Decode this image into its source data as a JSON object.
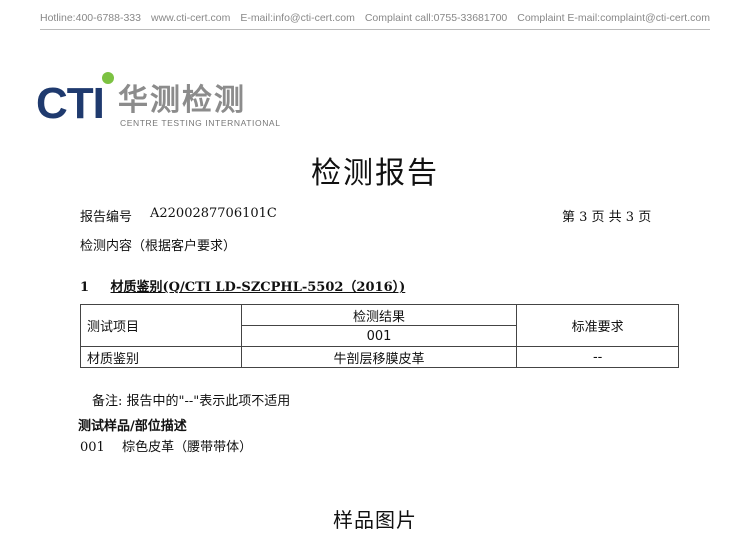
{
  "header": {
    "hotline": "Hotline:400-6788-333",
    "website": "www.cti-cert.com",
    "email": "E-mail:info@cti-cert.com",
    "complaint_call": "Complaint call:0755-33681700",
    "complaint_email": "Complaint E-mail:complaint@cti-cert.com"
  },
  "logo": {
    "brand": "CT",
    "brand_i": "I",
    "chinese": "华测检测",
    "english": "CENTRE TESTING INTERNATIONAL"
  },
  "title": "检测报告",
  "report": {
    "number_label": "报告编号",
    "number": "A2200287706101C",
    "page_info": "第 3 页   共 3 页",
    "content_label": "检测内容（根据客户要求）"
  },
  "section1": {
    "num": "1",
    "title": "材质鉴别(Q/CTI LD-SZCPHL-5502（2016）)"
  },
  "table": {
    "h_item": "测试项目",
    "h_result": "检测结果",
    "h_sample": "001",
    "h_standard": "标准要求",
    "row_item": "材质鉴别",
    "row_result": "牛剖层移膜皮革",
    "row_standard": "--"
  },
  "note": "备注:   报告中的\"--\"表示此项不适用",
  "sample": {
    "heading": "测试样品/部位描述",
    "id": "001",
    "desc": "棕色皮革（腰带带体）"
  },
  "picture_title": "样品图片"
}
